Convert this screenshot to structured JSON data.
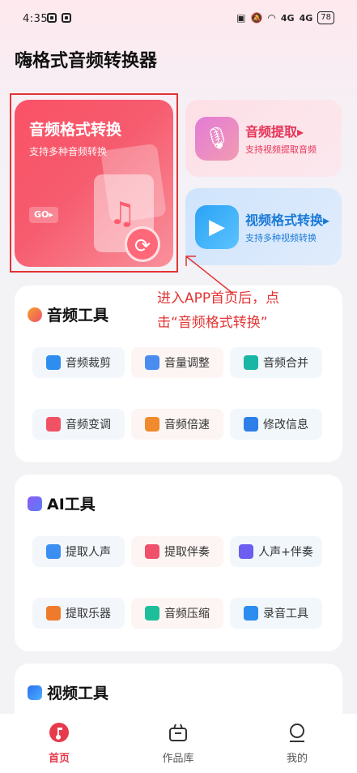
{
  "status_bar": {
    "time": "4:35",
    "signal1": "4G",
    "signal2": "4G",
    "battery": "78"
  },
  "app": {
    "title": "嗨格式音频转换器"
  },
  "features": {
    "main": {
      "title": "音频格式转换",
      "subtitle": "支持多种音频转换",
      "go_label": "GO▸"
    },
    "extract": {
      "title": "音频提取▸",
      "subtitle": "支持视频提取音频"
    },
    "video": {
      "title": "视频格式转换▸",
      "subtitle": "支持多种视频转换"
    }
  },
  "annotation": {
    "line1": "进入APP首页后，点",
    "line2": "击“音频格式转换”"
  },
  "audio_tools": {
    "title": "音频工具",
    "items": [
      {
        "label": "音频裁剪",
        "icon": "scissors-icon",
        "color": "#2e8ef0"
      },
      {
        "label": "音量调整",
        "icon": "volume-icon",
        "color": "#4a8cf0"
      },
      {
        "label": "音频合并",
        "icon": "merge-icon",
        "color": "#19b6a5"
      },
      {
        "label": "音频变调",
        "icon": "waveform-icon",
        "color": "#f05264"
      },
      {
        "label": "音频倍速",
        "icon": "speed-icon",
        "color": "#f08a2c"
      },
      {
        "label": "修改信息",
        "icon": "info-edit-icon",
        "color": "#2d7fe8"
      }
    ]
  },
  "ai_tools": {
    "title": "AI工具",
    "items": [
      {
        "label": "提取人声",
        "icon": "voice-icon",
        "color": "#3b8ef2"
      },
      {
        "label": "提取伴奏",
        "icon": "accompaniment-icon",
        "color": "#f0506a"
      },
      {
        "label": "人声+伴奏",
        "icon": "vocal-accompaniment-icon",
        "color": "#6b5ef0"
      },
      {
        "label": "提取乐器",
        "icon": "guitar-icon",
        "color": "#f07a2c"
      },
      {
        "label": "音频压缩",
        "icon": "compress-icon",
        "color": "#1dbf9a"
      },
      {
        "label": "录音工具",
        "icon": "microphone-icon",
        "color": "#2d8cf0"
      }
    ]
  },
  "video_tools": {
    "title": "视频工具"
  },
  "bottom_nav": {
    "home": "首页",
    "works": "作品库",
    "mine": "我的"
  },
  "colors": {
    "accent": "#f65b6e",
    "annotation": "#e23434"
  }
}
